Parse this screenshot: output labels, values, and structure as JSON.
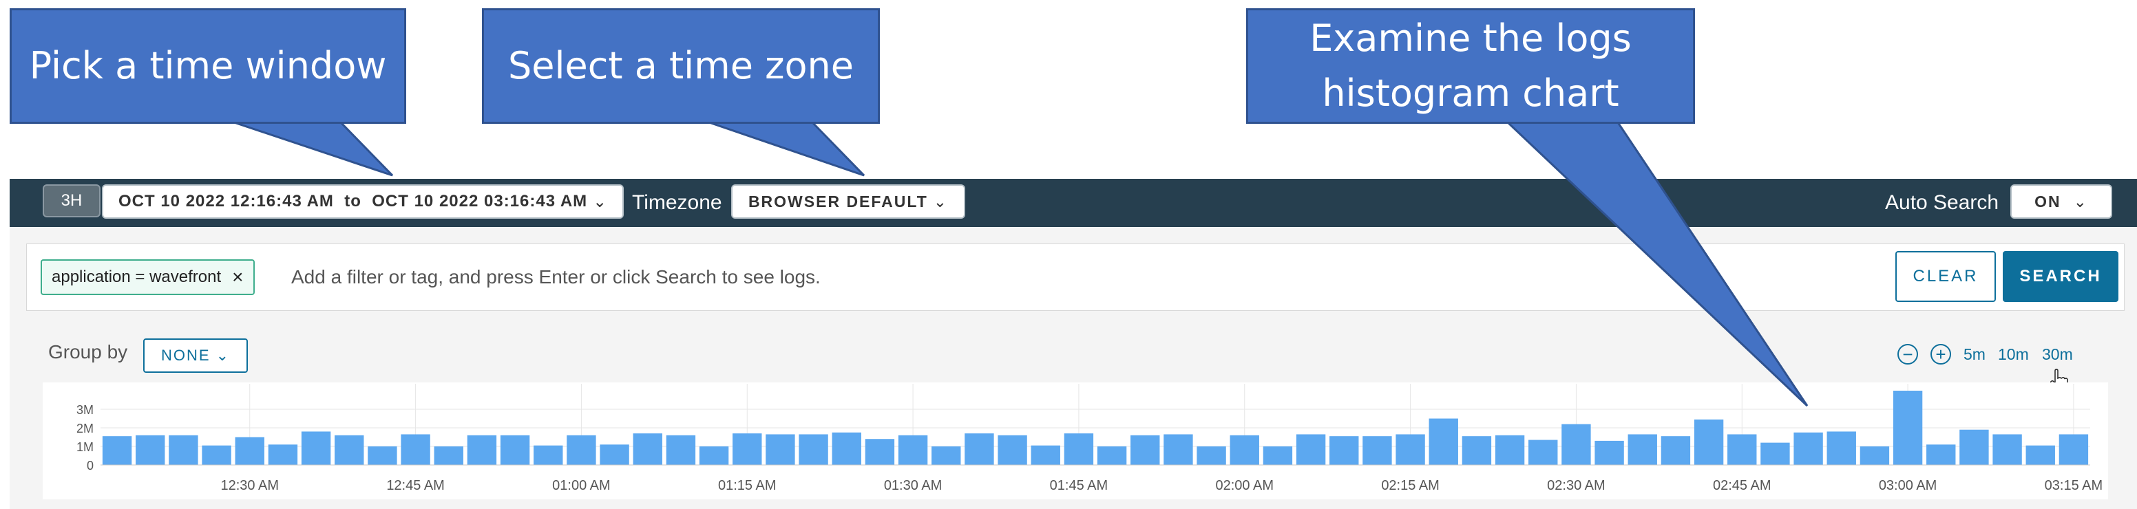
{
  "callouts": {
    "time_window": "Pick a time window",
    "time_zone": "Select a time zone",
    "histogram_line1": "Examine the logs",
    "histogram_line2": "histogram chart"
  },
  "toolbar": {
    "range_button": "3H",
    "date_range": "OCT 10 2022 12:16:43 AM  to  OCT 10 2022 03:16:43 AM",
    "timezone_label": "Timezone",
    "timezone_value": "BROWSER DEFAULT",
    "auto_search_label": "Auto Search",
    "auto_search_value": "ON",
    "chevron_icon": "chevron-down-icon"
  },
  "filter": {
    "pill_label": "application = wavefront",
    "pill_close_icon": "close-icon",
    "placeholder": "Add a filter or tag, and press Enter or click Search to see logs.",
    "clear_label": "CLEAR",
    "search_label": "SEARCH"
  },
  "chart_controls": {
    "group_by_label": "Group by",
    "group_by_value": "NONE",
    "zoom_out_icon": "zoom-out-icon",
    "zoom_in_icon": "zoom-in-icon",
    "zoom_5m": "5m",
    "zoom_10m": "10m",
    "zoom_30m": "30m"
  },
  "colors": {
    "toolbar_bg": "#263f4f",
    "accent": "#0d6f9b",
    "bar": "#5ca8f0",
    "callout": "#4472c4"
  },
  "chart_data": {
    "type": "bar",
    "y_ticks": [
      "3M",
      "2M",
      "1M",
      "0"
    ],
    "ylim": [
      0,
      4000000
    ],
    "x_ticks": [
      "12:30 AM",
      "12:45 AM",
      "01:00 AM",
      "01:15 AM",
      "01:30 AM",
      "01:45 AM",
      "02:00 AM",
      "02:15 AM",
      "02:30 AM",
      "02:45 AM",
      "03:00 AM",
      "03:15 AM"
    ],
    "x_tick_bar_index": [
      4,
      9,
      14,
      19,
      24,
      29,
      34,
      39,
      44,
      49,
      54,
      59
    ],
    "values": [
      1550000,
      1600000,
      1600000,
      1050000,
      1500000,
      1100000,
      1800000,
      1600000,
      1000000,
      1650000,
      1000000,
      1600000,
      1600000,
      1050000,
      1600000,
      1100000,
      1700000,
      1600000,
      1000000,
      1700000,
      1650000,
      1650000,
      1750000,
      1400000,
      1600000,
      1000000,
      1700000,
      1600000,
      1050000,
      1700000,
      1000000,
      1600000,
      1650000,
      1000000,
      1600000,
      1000000,
      1650000,
      1550000,
      1550000,
      1650000,
      2500000,
      1550000,
      1600000,
      1350000,
      2200000,
      1300000,
      1650000,
      1550000,
      2450000,
      1650000,
      1200000,
      1750000,
      1800000,
      1000000,
      4000000,
      1100000,
      1900000,
      1650000,
      1050000,
      1650000
    ],
    "grid": true
  }
}
